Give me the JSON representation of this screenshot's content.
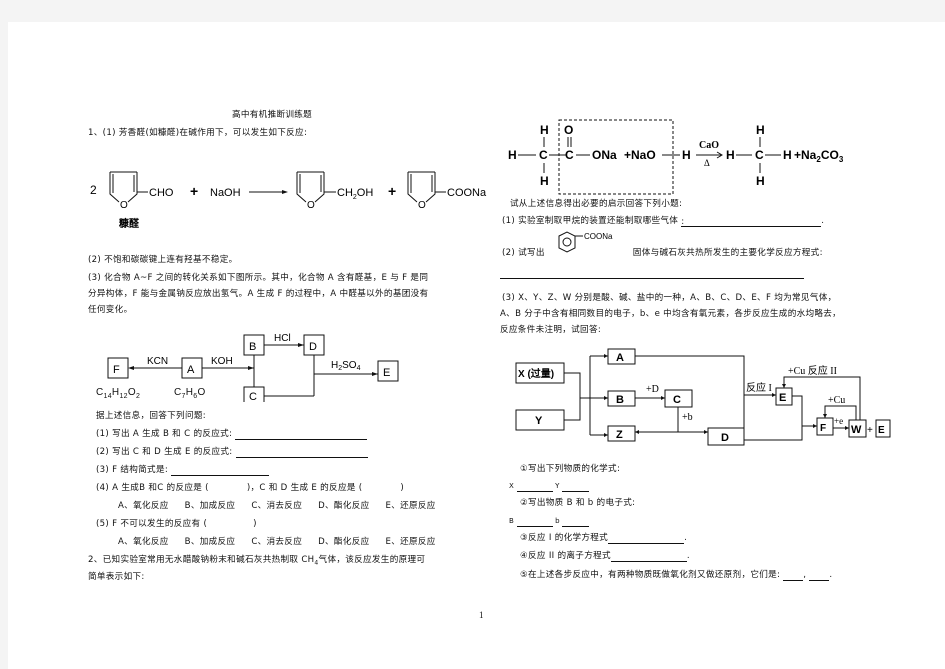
{
  "title": "高中有机推断训练题",
  "q1": {
    "intro": "1、(1) 芳香醛(如糠醛)在碱作用下，可以发生如下反应:",
    "reaction": {
      "coef": "2",
      "reactant_group": "CHO",
      "reactant_name": "糠醛",
      "plus": "+",
      "reagent": "NaOH",
      "product1_group_a": "CH",
      "product1_sub": "2",
      "product1_group_b": "OH",
      "product2_group": "COONa",
      "ring_atom": "O"
    },
    "note2": "(2) 不饱和碳碳键上连有羟基不稳定。",
    "note3_lines": [
      "(3) 化合物 A~F 之间的转化关系如下图所示。其中，化合物  A 含有醛基，E 与 F 是同",
      "分异构体，F 能与金属钠反应放出氢气。A 生成 F 的过程中，A 中醛基以外的基团没有",
      "任何变化。"
    ],
    "scheme": {
      "nodes": {
        "A": "A",
        "B": "B",
        "C": "C",
        "D": "D",
        "E": "E",
        "F": "F"
      },
      "reagents": {
        "kcn": "KCN",
        "koh": "KOH",
        "hcl": "HCl",
        "h2so4_a": "H",
        "h2so4_sub1": "2",
        "h2so4_b": "SO",
        "h2so4_sub2": "4"
      },
      "formula_F": {
        "c": "C",
        "c_n": "14",
        "h": "H",
        "h_n": "12",
        "o": "O",
        "o_n": "2"
      },
      "formula_A": {
        "c": "C",
        "c_n": "7",
        "h": "H",
        "h_n": "6",
        "o": "O"
      }
    },
    "prompt": "据上述信息，回答下列问题:",
    "questions": [
      "(1) 写出 A 生成 B 和 C 的反应式:",
      "(2) 写出 C 和 D 生成 E 的反应式:",
      "(3) F 结构简式是:"
    ],
    "q4": {
      "part1": "(4) A 生成B 和C 的反应是 (",
      "part2": ")，C 和 D 生成 E 的反应是 (",
      "part3": ")"
    },
    "options": [
      "A、氧化反应",
      "B、加成反应",
      "C、消去反应",
      "D、酯化反应",
      "E、还原反应"
    ],
    "q5": {
      "part1": "(5) F 不可以发生的反应有 (",
      "part2": ")"
    }
  },
  "q2": {
    "intro_lines": [
      "2、已知实验室常用无水醋酸钠粉末和碱石灰共热制取  CH",
      "简单表示如下:"
    ],
    "intro_sub": "4",
    "intro_tail": "气体，该反应发生的原理可",
    "reaction": {
      "h": "H",
      "c": "C",
      "o": "O",
      "ona": "ONa",
      "plus_nao": "+NaO",
      "catalyst": "CaO",
      "heat": "Δ",
      "plus_na": "+Na",
      "na_sub": "2",
      "co": "CO",
      "co_sub": "3"
    },
    "prompt": "试从上述信息得出必要的启示回答下列小题:",
    "sub1": "(1) 实验室制取甲烷的装置还能制取哪些气体",
    "sub1_colon": ":",
    "sub1_end": ".",
    "sub2_a": "(2) 试写出",
    "sub2_group": "COONa",
    "sub2_b": "固体与碱石灰共热所发生的主要化学反应方程式:"
  },
  "q3": {
    "intro_lines": [
      "(3) X、Y、Z、W 分别是酸、碱、盐中的一种，A、B、C、D、E、F 均为常见气体，",
      "A、B 分子中含有相同数目的电子，b、e 中均含有氧元素，各步反应生成的水均略去，",
      "反应条件未注明，试回答:"
    ],
    "scheme": {
      "X": "X (过量)",
      "Y": "Y",
      "A": "A",
      "B": "B",
      "C": "C",
      "Z": "Z",
      "D": "D",
      "E": "E",
      "F": "F",
      "W": "W",
      "E2": "E",
      "plusD": "+D",
      "plusb": "+b",
      "r1": "反应 I",
      "r2": "+Cu 反应 II",
      "plusCu": "+Cu",
      "pluse": "+e",
      "plus": "+"
    },
    "items": {
      "i1": "①写出下列物质的化学式:",
      "x_label": "X",
      "y_label": "Y",
      "i2": "②写出物质 B 和 b 的电子式:",
      "b_label": "B",
      "bb_label": "b",
      "i3": "③反应 I 的化学方程式",
      "i4": "④反应 II 的离子方程式",
      "i5": "⑤在上述各步反应中，有两种物质既做氧化剂又做还原剂，它们是:",
      "comma": ",",
      "period": "."
    }
  },
  "page_number": "1"
}
